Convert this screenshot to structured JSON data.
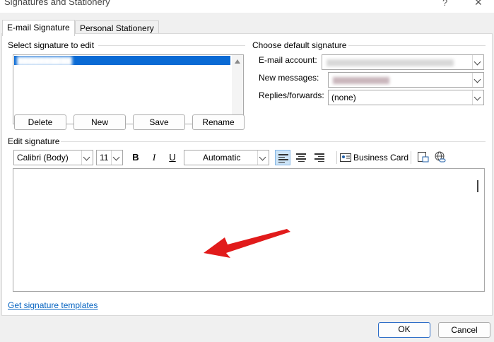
{
  "window": {
    "title": "Signatures and Stationery",
    "help_glyph": "?",
    "close_glyph": "✕"
  },
  "tabs": [
    {
      "label": "E-mail Signature",
      "active": true
    },
    {
      "label": "Personal Stationery",
      "active": false
    }
  ],
  "select_signature": {
    "label": "Select signature to edit",
    "buttons": {
      "delete": "Delete",
      "new": "New",
      "save": "Save",
      "rename": "Rename"
    }
  },
  "default_signature": {
    "label": "Choose default signature",
    "email_account_label": "E-mail account:",
    "new_messages_label": "New messages:",
    "replies_label": "Replies/forwards:",
    "replies_value": "(none)"
  },
  "edit_signature": {
    "label": "Edit signature",
    "font": "Calibri (Body)",
    "size": "11",
    "bold": "B",
    "italic": "I",
    "underline": "U",
    "color": "Automatic",
    "business_card": "Business Card"
  },
  "footer": {
    "templates_link": "Get signature templates",
    "ok": "OK",
    "cancel": "Cancel"
  },
  "colors": {
    "selection": "#0a6ad4",
    "annotation_arrow": "#e11b1b",
    "link": "#0563c1",
    "ok_border": "#2b6cc7"
  }
}
